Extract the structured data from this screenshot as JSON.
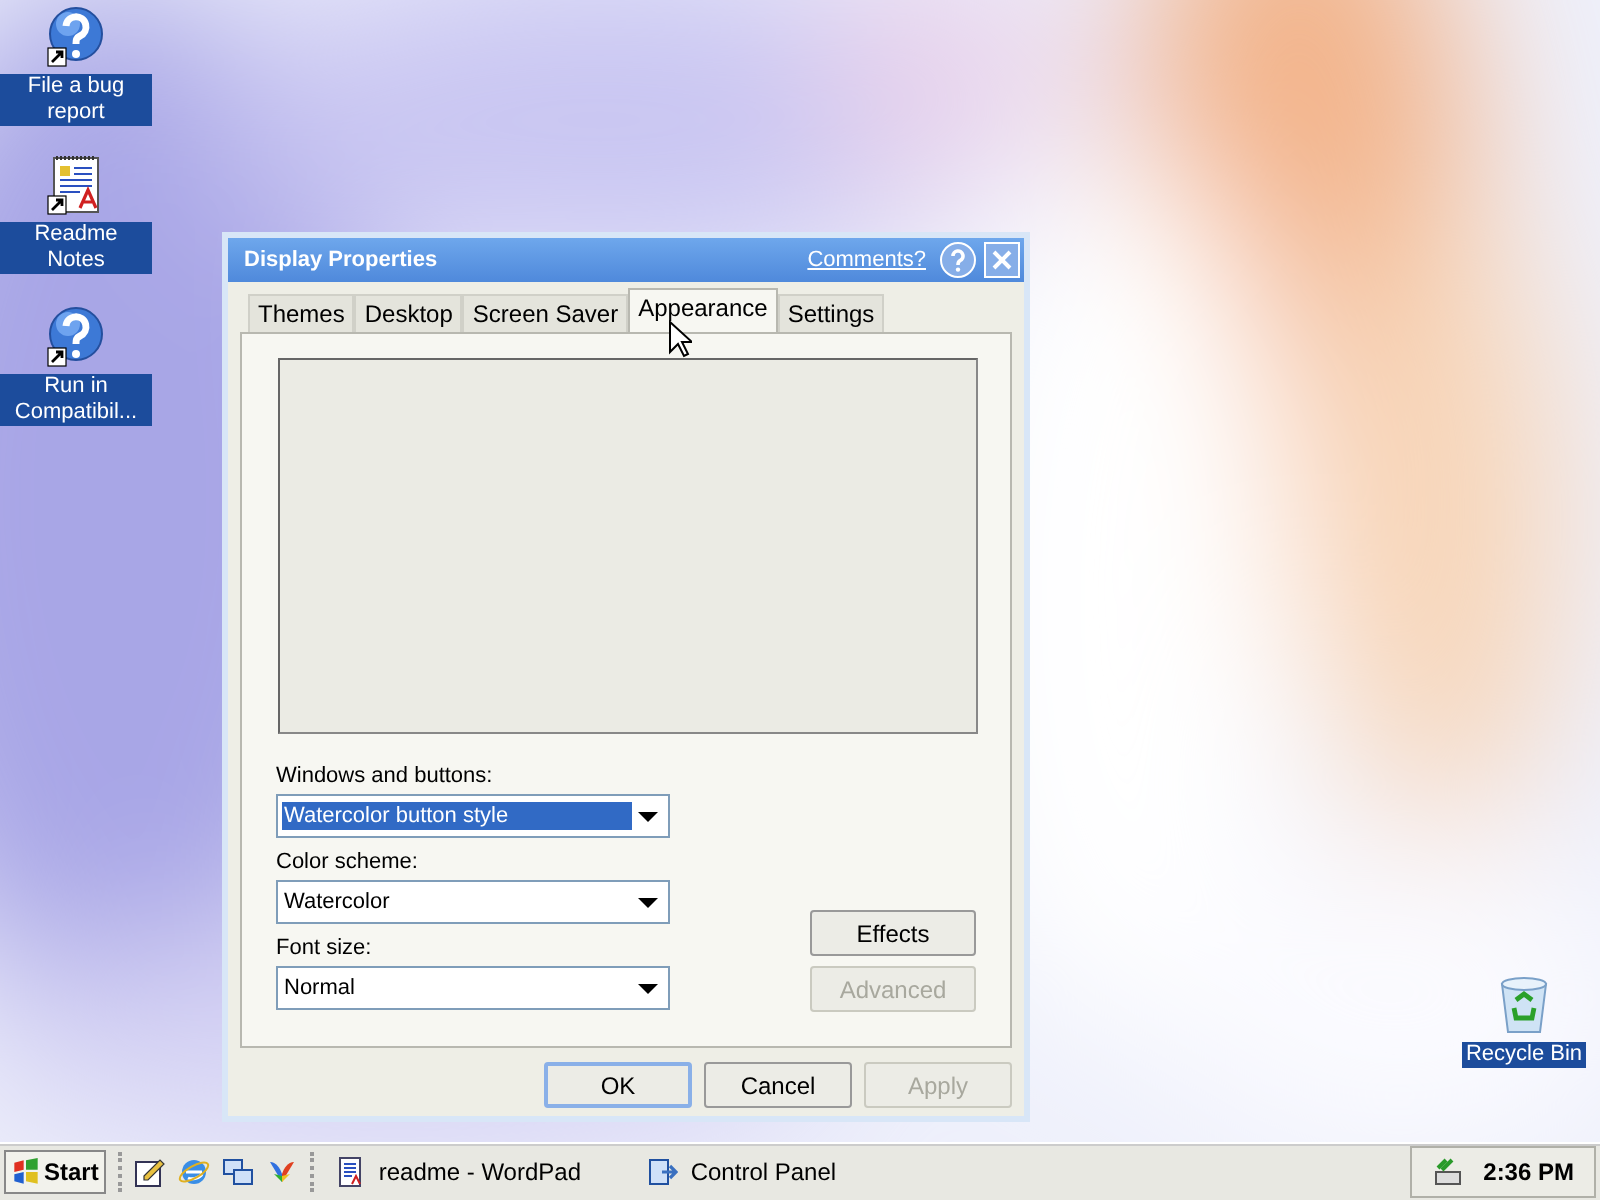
{
  "desktop_icons": [
    {
      "label": "File a bug report",
      "kind": "help",
      "selected": true
    },
    {
      "label": "Readme Notes",
      "kind": "document",
      "selected": true
    },
    {
      "label": "Run in Compatibil...",
      "kind": "help",
      "selected": true
    },
    {
      "label": "Recycle Bin",
      "kind": "recycle",
      "selected": true
    }
  ],
  "window": {
    "title": "Display Properties",
    "comments_link": "Comments?",
    "tabs": [
      {
        "label": "Themes",
        "selected": false
      },
      {
        "label": "Desktop",
        "selected": false
      },
      {
        "label": "Screen Saver",
        "selected": false
      },
      {
        "label": "Appearance",
        "selected": true
      },
      {
        "label": "Settings",
        "selected": false
      }
    ],
    "fields": [
      {
        "label": "Windows and buttons:",
        "value": "Watercolor button style",
        "selected": true
      },
      {
        "label": "Color scheme:",
        "value": "Watercolor",
        "selected": false
      },
      {
        "label": "Font size:",
        "value": "Normal",
        "selected": false
      }
    ],
    "side_buttons": [
      {
        "label": "Effects",
        "disabled": false
      },
      {
        "label": "Advanced",
        "disabled": true
      }
    ],
    "buttons": [
      {
        "label": "OK",
        "default": true,
        "disabled": false
      },
      {
        "label": "Cancel",
        "default": false,
        "disabled": false
      },
      {
        "label": "Apply",
        "default": false,
        "disabled": true
      }
    ]
  },
  "taskbar": {
    "start": "Start",
    "quick_launch": [
      {
        "kind": "note"
      },
      {
        "kind": "browser"
      },
      {
        "kind": "windows"
      },
      {
        "kind": "butterfly"
      }
    ],
    "tasks": [
      {
        "label": "readme - WordPad",
        "kind": "document"
      },
      {
        "label": "Control Panel",
        "kind": "panel"
      }
    ],
    "clock": "2:36 PM"
  }
}
